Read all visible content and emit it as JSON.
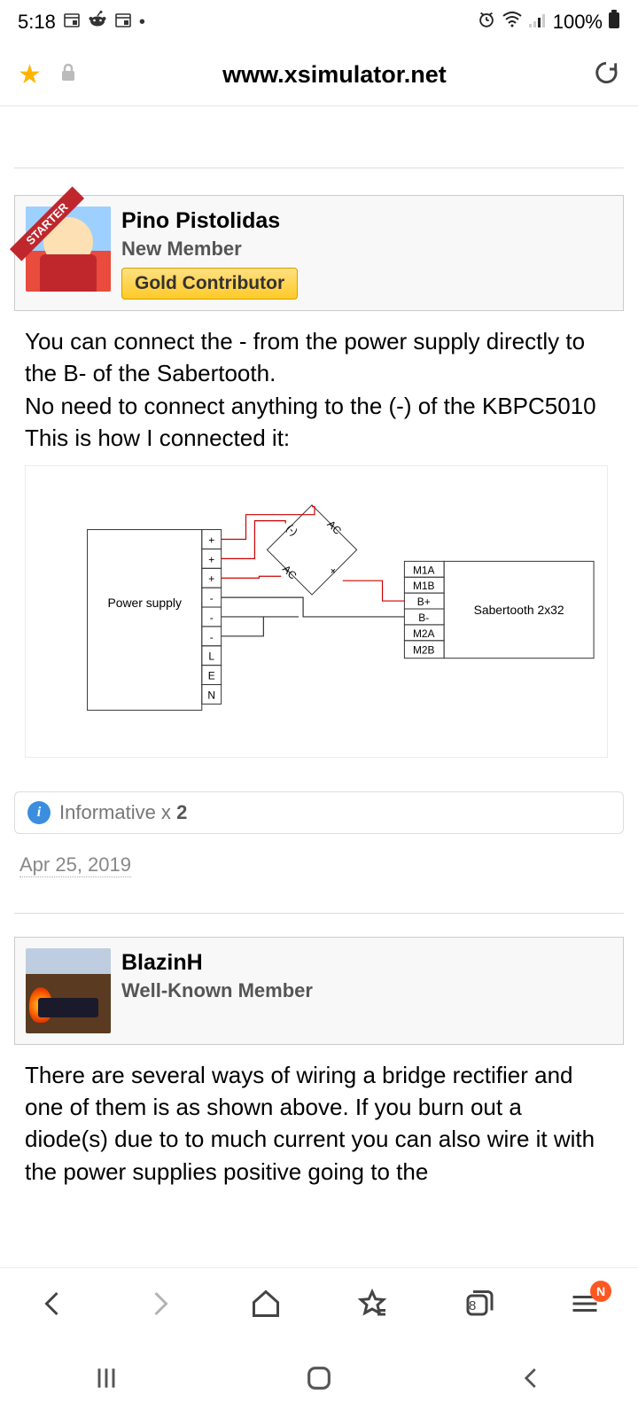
{
  "status": {
    "time": "5:18",
    "battery": "100%"
  },
  "browser": {
    "url": "www.xsimulator.net"
  },
  "post1": {
    "ribbon": "STARTER",
    "username": "Pino Pistolidas",
    "title": "New Member",
    "badge": "Gold Contributor",
    "body_line1": "You can connect the - from the power supply directly to the B- of the Sabertooth.",
    "body_line2": "No need to connect anything to the (-) of the KBPC5010",
    "body_line3": "This is how I connected it:",
    "reaction_label": "Informative x",
    "reaction_count": "2",
    "date": "Apr 25, 2019"
  },
  "diagram": {
    "power_supply": "Power supply",
    "sabertooth": "Sabertooth 2x32",
    "ps_terminals": [
      "+",
      "+",
      "+",
      "-",
      "-",
      "-",
      "L",
      "E",
      "N"
    ],
    "st_terminals": [
      "M1A",
      "M1B",
      "B+",
      "B-",
      "M2A",
      "M2B"
    ],
    "rect": {
      "ac1": "AC",
      "ac2": "AC",
      "plus": "+",
      "minus": "(-)"
    }
  },
  "post2": {
    "username": "BlazinH",
    "title": "Well-Known Member",
    "body": "There are several ways of wiring a bridge rectifier and one of them is as shown above. If you burn out a diode(s) due to to much current you can also wire it with the power supplies positive going to the"
  },
  "toolbar": {
    "tab_count": "8",
    "notif": "N"
  }
}
